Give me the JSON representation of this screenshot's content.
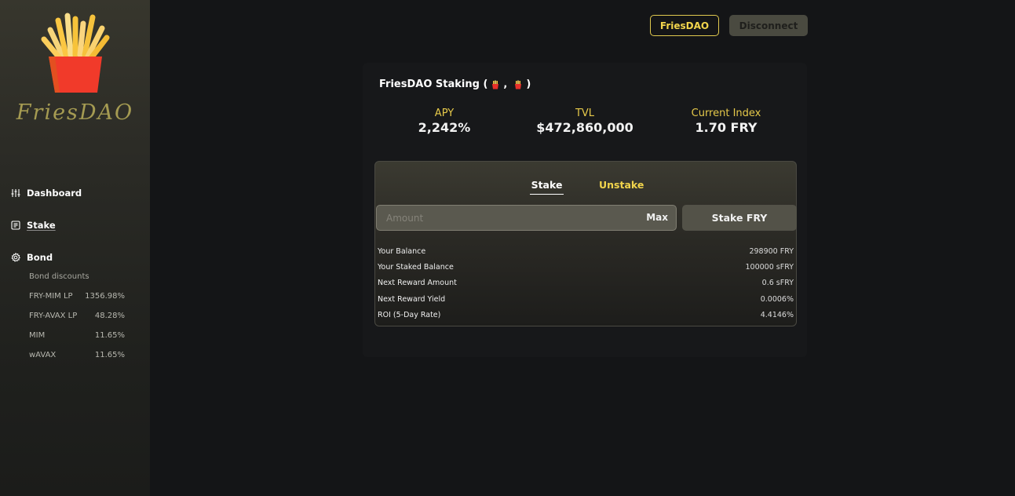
{
  "sidebar": {
    "brand": "FriesDAO",
    "nav": [
      {
        "label": "Dashboard",
        "icon": "sliders-icon"
      },
      {
        "label": "Stake",
        "icon": "document-icon"
      },
      {
        "label": "Bond",
        "icon": "gear-icon"
      }
    ],
    "bond_discounts_label": "Bond discounts",
    "bonds": [
      {
        "name": "FRY-MIM LP",
        "discount": "1356.98%"
      },
      {
        "name": "FRY-AVAX LP",
        "discount": "48.28%"
      },
      {
        "name": "MIM",
        "discount": "11.65%"
      },
      {
        "name": "wAVAX",
        "discount": "11.65%"
      }
    ]
  },
  "header": {
    "account_label": "FriesDAO",
    "disconnect_label": "Disconnect"
  },
  "card": {
    "title_prefix": "FriesDAO Staking (",
    "title_sep": ",",
    "title_suffix": ")",
    "stats": [
      {
        "label": "APY",
        "value": "2,242%"
      },
      {
        "label": "TVL",
        "value": "$472,860,000"
      },
      {
        "label": "Current Index",
        "value": "1.70 FRY"
      }
    ],
    "tabs": [
      {
        "label": "Stake",
        "active": true
      },
      {
        "label": "Unstake",
        "active": false
      }
    ],
    "amount_placeholder": "Amount",
    "amount_value": "",
    "max_label": "Max",
    "stake_button": "Stake FRY",
    "info": [
      {
        "label": "Your Balance",
        "value": "298900 FRY"
      },
      {
        "label": "Your Staked Balance",
        "value": "100000 sFRY"
      },
      {
        "label": "Next Reward Amount",
        "value": "0.6 sFRY"
      },
      {
        "label": "Next Reward Yield",
        "value": "0.0006%"
      },
      {
        "label": "ROI (5-Day Rate)",
        "value": "4.4146%"
      }
    ]
  },
  "colors": {
    "accent": "#f1d44c",
    "background": "#141517",
    "brand_text": "#a59b52"
  }
}
